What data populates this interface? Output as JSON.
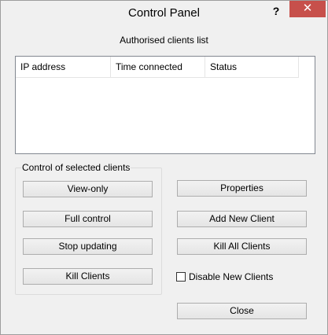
{
  "window": {
    "title": "Control Panel",
    "help_glyph": "?",
    "close_glyph": "✕"
  },
  "clients": {
    "caption": "Authorised clients list",
    "columns": [
      "IP address",
      "Time connected",
      "Status"
    ],
    "rows": []
  },
  "control": {
    "group_label": "Control of selected clients",
    "view_only": "View-only",
    "full_control": "Full control",
    "stop_updating": "Stop updating",
    "kill_clients": "Kill Clients"
  },
  "actions": {
    "properties": "Properties",
    "add_new_client": "Add New Client",
    "kill_all_clients": "Kill All Clients",
    "disable_new_clients": "Disable New Clients",
    "disable_new_clients_checked": false,
    "close": "Close"
  },
  "colors": {
    "close_button": "#c7504b"
  }
}
